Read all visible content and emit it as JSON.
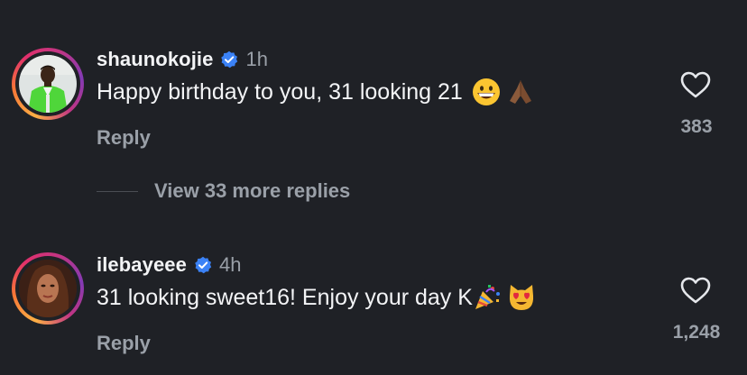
{
  "comments": [
    {
      "username": "shaunokojie",
      "time": "1h",
      "text": "Happy birthday to you, 31 looking 21",
      "emojis": [
        "grinning-face",
        "folded-hands"
      ],
      "reply_label": "Reply",
      "likes": "383",
      "avatar": "shaunokojie-avatar"
    },
    {
      "username": "ilebayeee",
      "time": "4h",
      "text": "31 looking sweet16! Enjoy your day K",
      "emojis": [
        "party-popper",
        "heart-eyes-cat"
      ],
      "reply_label": "Reply",
      "likes": "1,248",
      "avatar": "ilebayeee-avatar"
    }
  ],
  "view_more_replies": "View 33 more replies",
  "colors": {
    "background": "#1f2126",
    "primary_text": "#f3f4f6",
    "secondary_text": "#9aa0a8",
    "verified_blue": "#3b82f6"
  }
}
